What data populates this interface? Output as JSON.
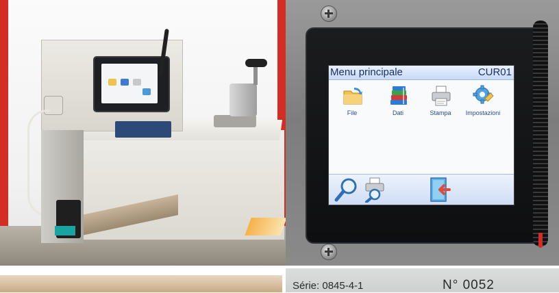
{
  "touchscreen": {
    "header_title": "Menu principale",
    "header_code": "CUR01",
    "menu_items": [
      {
        "label": "File",
        "icon": "folder-icon"
      },
      {
        "label": "Dati",
        "icon": "books-icon"
      },
      {
        "label": "Stampa",
        "icon": "printer-icon"
      },
      {
        "label": "Impostazioni",
        "icon": "settings-gear-icon"
      }
    ],
    "bottom_buttons": [
      {
        "icon": "magnifier-icon"
      },
      {
        "icon": "print-preview-icon"
      },
      {
        "icon": "exit-door-icon"
      }
    ]
  },
  "nameplate": {
    "serial": "Série: 0845-4-1",
    "number": "N° 0052"
  },
  "colors": {
    "accent_red": "#d42d24",
    "screen_header_text": "#1a2f6b",
    "teal_cartridge": "#1aa3a3"
  }
}
